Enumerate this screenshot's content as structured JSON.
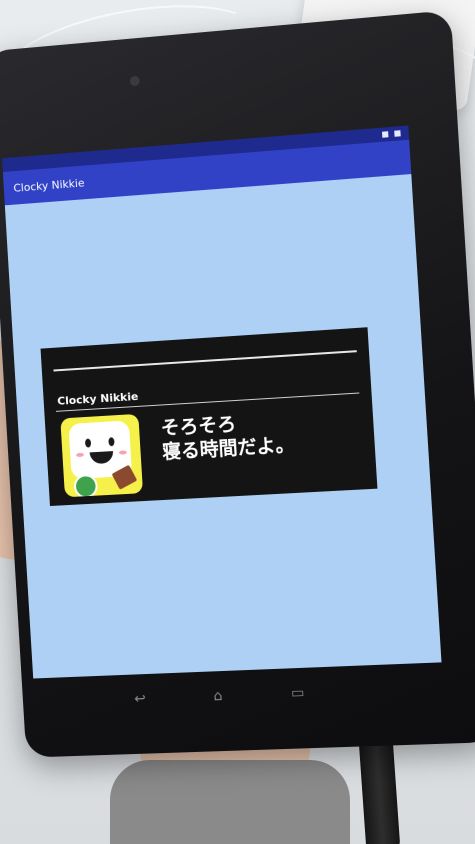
{
  "app": {
    "title": "Clocky Nikkie"
  },
  "notification": {
    "app_name": "Clocky Nikkie",
    "message_line1": "そろそろ",
    "message_line2": "寝る時間だよ。"
  },
  "nav": {
    "back_icon": "↩",
    "home_icon": "⌂",
    "recents_icon": "▭"
  },
  "colors": {
    "app_bar": "#3142c7",
    "status_bar": "#1f2a8f",
    "screen_background": "#aed0f4",
    "notification_background": "#141414",
    "icon_background": "#f6f04a"
  }
}
